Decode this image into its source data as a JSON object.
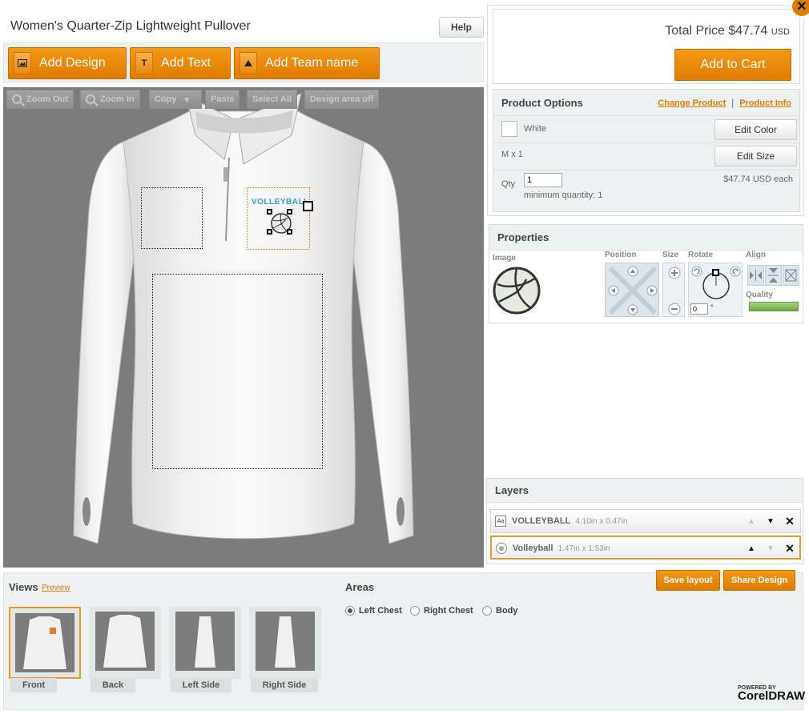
{
  "product": {
    "title": "Women's Quarter-Zip Lightweight Pullover",
    "help_label": "Help"
  },
  "toolbar": {
    "add_design": "Add Design",
    "add_design_icon": "image-icon",
    "add_text": "Add Text",
    "add_text_icon_glyph": "T",
    "add_team": "Add Team name",
    "add_team_icon": "triangle-icon"
  },
  "canvas": {
    "zoom_out": "Zoom Out",
    "zoom_in": "Zoom In",
    "copy": "Copy",
    "paste": "Paste",
    "select_all": "Select All",
    "design_area": "Design area off",
    "design_text": "VOLLEYBALL"
  },
  "price": {
    "total_label": "Total Price $47.74",
    "currency": "USD",
    "add_to_cart": "Add to Cart",
    "close_glyph": "✕"
  },
  "options": {
    "title": "Product Options",
    "change_product": "Change Product",
    "separator": "|",
    "product_info": "Product Info",
    "color_name": "White",
    "edit_color": "Edit Color",
    "size_text": "M x 1",
    "edit_size": "Edit Size",
    "qty_label": "Qty",
    "qty_value": "1",
    "minimum": "minimum quantity: 1",
    "each_price": "$47.74 USD each"
  },
  "properties": {
    "title": "Properties",
    "image_label": "Image",
    "position_label": "Position",
    "size_label": "Size",
    "rotate_label": "Rotate",
    "align_label": "Align",
    "quality_label": "Quality",
    "quality_value": 1.0,
    "rotate_value": "0",
    "degree": "°"
  },
  "layers": {
    "title": "Layers",
    "items": [
      {
        "name": "VOLLEYBALL",
        "dims": "4.10in x 0.47in",
        "icon": "text-layer-icon",
        "icon_glyph": "Aa"
      },
      {
        "name": "Volleyball",
        "dims": "1.47in x 1.53in",
        "icon": "volleyball-icon",
        "icon_glyph": "◍"
      }
    ],
    "save_layout": "Save layout",
    "share_design": "Share Design"
  },
  "views": {
    "title": "Views",
    "preview": "Preview",
    "items": [
      "Front",
      "Back",
      "Left Side",
      "Right Side"
    ]
  },
  "areas": {
    "title": "Areas",
    "options": [
      "Left Chest",
      "Right Chest",
      "Body"
    ],
    "selected": "Left Chest"
  },
  "branding": {
    "powered": "POWERED BY",
    "name": "CorelDRAW"
  },
  "colors": {
    "accent": "#e07b00",
    "canvas_bg": "#7c7c7c",
    "panel_bg": "#eef1f1"
  }
}
